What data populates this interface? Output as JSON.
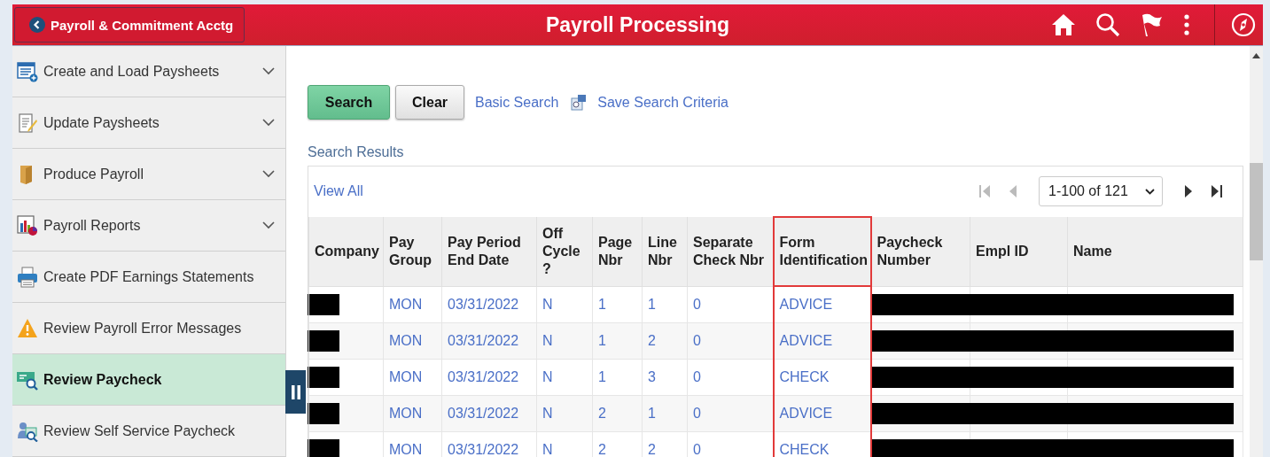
{
  "header": {
    "back_button": "Payroll & Commitment Acctg",
    "title": "Payroll Processing"
  },
  "sidebar": {
    "items": [
      {
        "label": "Create and Load Paysheets",
        "expandable": true,
        "selected": false
      },
      {
        "label": "Update Paysheets",
        "expandable": true,
        "selected": false
      },
      {
        "label": "Produce Payroll",
        "expandable": true,
        "selected": false
      },
      {
        "label": "Payroll Reports",
        "expandable": true,
        "selected": false
      },
      {
        "label": "Create PDF Earnings Statements",
        "expandable": false,
        "selected": false
      },
      {
        "label": "Review Payroll Error Messages",
        "expandable": false,
        "selected": false
      },
      {
        "label": "Review Paycheck",
        "expandable": false,
        "selected": true
      },
      {
        "label": "Review Self Service Paycheck",
        "expandable": false,
        "selected": false
      }
    ]
  },
  "toolbar": {
    "search_button": "Search",
    "clear_button": "Clear",
    "basic_search_link": "Basic Search",
    "save_criteria_link": "Save Search Criteria"
  },
  "results": {
    "title": "Search Results",
    "view_all": "View All",
    "pager": {
      "first_disabled": true,
      "prev_disabled": true,
      "range": "1-100 of 121"
    }
  },
  "table": {
    "columns": [
      {
        "label": "Company",
        "highlighted": false
      },
      {
        "label": "Pay Group",
        "highlighted": false
      },
      {
        "label": "Pay Period End Date",
        "highlighted": false
      },
      {
        "label": "Off Cycle ?",
        "highlighted": false
      },
      {
        "label": "Page Nbr",
        "highlighted": false
      },
      {
        "label": "Line Nbr",
        "highlighted": false
      },
      {
        "label": "Separate Check Nbr",
        "highlighted": false
      },
      {
        "label": "Form Identification",
        "highlighted": true
      },
      {
        "label": "Paycheck Number",
        "highlighted": false
      },
      {
        "label": "Empl ID",
        "highlighted": false
      },
      {
        "label": "Name",
        "highlighted": false
      }
    ],
    "rows": [
      {
        "redacted": true,
        "cells": [
          "",
          "MON",
          "03/31/2022",
          "N",
          "1",
          "1",
          "0",
          "ADVICE",
          "",
          "",
          ""
        ]
      },
      {
        "redacted": true,
        "cells": [
          "",
          "MON",
          "03/31/2022",
          "N",
          "1",
          "2",
          "0",
          "ADVICE",
          "",
          "",
          ""
        ]
      },
      {
        "redacted": true,
        "cells": [
          "",
          "MON",
          "03/31/2022",
          "N",
          "1",
          "3",
          "0",
          "CHECK",
          "",
          "",
          ""
        ]
      },
      {
        "redacted": true,
        "cells": [
          "",
          "MON",
          "03/31/2022",
          "N",
          "2",
          "1",
          "0",
          "ADVICE",
          "",
          "",
          ""
        ]
      },
      {
        "redacted": true,
        "cells": [
          "",
          "MON",
          "03/31/2022",
          "N",
          "2",
          "2",
          "0",
          "CHECK",
          "",
          "",
          ""
        ]
      }
    ]
  }
}
